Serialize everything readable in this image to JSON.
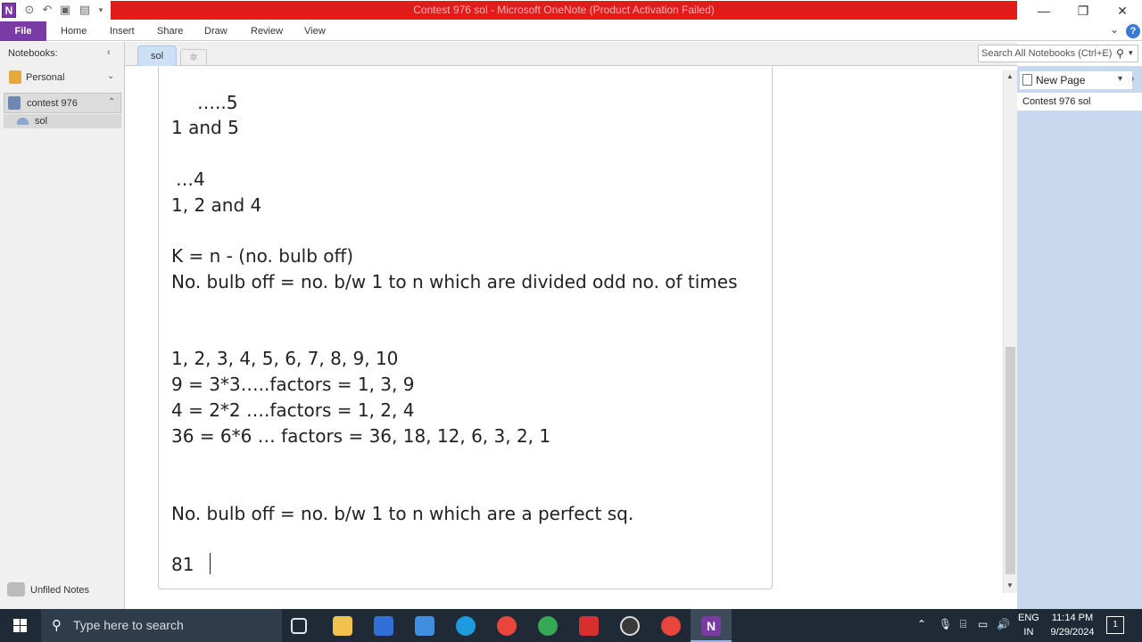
{
  "window": {
    "title": "Contest 976 sol - Microsoft OneNote (Product Activation Failed)",
    "app_icon_letter": "N"
  },
  "ribbon": {
    "tabs": [
      "File",
      "Home",
      "Insert",
      "Share",
      "Draw",
      "Review",
      "View"
    ]
  },
  "nav": {
    "header": "Notebooks:",
    "notebooks": [
      {
        "label": "Personal",
        "color": "#e6a93a"
      },
      {
        "label": "contest 976",
        "color": "#6f87b3"
      }
    ],
    "section": "sol",
    "unfiled": "Unfiled Notes"
  },
  "section_tab": "sol",
  "search": {
    "placeholder": "Search All Notebooks (Ctrl+E)"
  },
  "page_pane": {
    "new_page": "New Page",
    "pages": [
      "Contest 976 sol"
    ]
  },
  "note_lines": [
    "…..5",
    "1 and 5",
    "…4",
    "1, 2 and 4",
    "K = n - (no. bulb off)",
    "No. bulb off = no. b/w 1 to n which are divided odd no. of times",
    "1, 2, 3, 4, 5, 6, 7, 8, 9, 10",
    "9 = 3*3…..factors =  1, 3, 9",
    "4 = 2*2 ….factors  = 1, 2, 4",
    "36 = 6*6 … factors  = 36, 18, 12, 6, 3, 2, 1",
    "No. bulb off = no. b/w 1 to n which are a perfect sq.",
    "81"
  ],
  "taskbar": {
    "search_placeholder": "Type here to search",
    "lang_1": "ENG",
    "lang_2": "IN",
    "time": "11:14 PM",
    "date": "9/29/2024",
    "app_icons": [
      {
        "name": "task-view-icon",
        "color": "#1f2a36"
      },
      {
        "name": "file-explorer-icon",
        "color": "#f2c14e"
      },
      {
        "name": "microsoft-store-icon",
        "color": "#2f6fd6"
      },
      {
        "name": "mail-icon",
        "color": "#3f8ee0"
      },
      {
        "name": "edge-icon",
        "color": "#1e9be0"
      },
      {
        "name": "chrome-icon",
        "color": "#e8453c"
      },
      {
        "name": "chrome-profile-icon",
        "color": "#34a853"
      },
      {
        "name": "colorful-app-icon",
        "color": "#d6302e"
      },
      {
        "name": "obs-icon",
        "color": "#3a3a3a"
      },
      {
        "name": "chrome-alt-icon",
        "color": "#e8453c"
      },
      {
        "name": "onenote-icon",
        "color": "#7b3ba5"
      }
    ]
  },
  "colors": {
    "accent": "#7b3ba5",
    "title_bar": "#e21b1b",
    "page_pane": "#c7d8ef",
    "taskbar": "#1f2a36"
  }
}
